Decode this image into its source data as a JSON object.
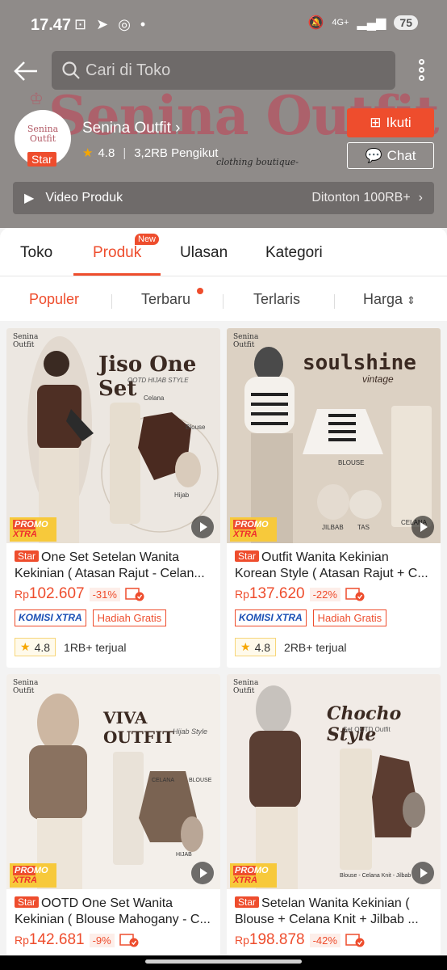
{
  "status": {
    "time": "17.47",
    "network": "4G+",
    "battery": "75"
  },
  "search": {
    "placeholder": "Cari di Toko"
  },
  "banner": {
    "brand": "Senina Outfit",
    "subtitle": "clothing boutique-"
  },
  "shop": {
    "name": "Senina Outfit",
    "logo_text": "Senina Outfit",
    "badge": "Star",
    "rating": "4.8",
    "followers": "3,2RB Pengikut",
    "follow_label": "Ikuti",
    "chat_label": "Chat"
  },
  "video": {
    "label": "Video Produk",
    "views": "Ditonton 100RB+"
  },
  "tabs": [
    {
      "label": "Toko"
    },
    {
      "label": "Produk",
      "badge": "New"
    },
    {
      "label": "Ulasan"
    },
    {
      "label": "Kategori"
    }
  ],
  "sort": [
    "Populer",
    "Terbaru",
    "Terlaris",
    "Harga"
  ],
  "colors": {
    "accent": "#ee4d2d",
    "header_bg": "#8f8b89"
  },
  "products": [
    {
      "badge": "Star",
      "name": "One Set Setelan Wanita Kekinian ( Atasan Rajut - Celan...",
      "price_cur": "Rp",
      "price": "102.607",
      "discount": "-31%",
      "tag1": "KOMISI XTRA",
      "tag2": "Hadiah Gratis",
      "rating": "4.8",
      "sold": "1RB+ terjual",
      "img_title": "Jiso One Set",
      "img_sub": "OOTD HIJAB STYLE",
      "img_brand": "Senina Outfit",
      "img_labels": [
        "Celana",
        "Blouse",
        "Hijab"
      ],
      "promo": "PROMO",
      "promo2": "XTRA"
    },
    {
      "badge": "Star",
      "name": "Outfit Wanita Kekinian Korean Style ( Atasan Rajut + C...",
      "price_cur": "Rp",
      "price": "137.620",
      "discount": "-22%",
      "tag1": "KOMISI XTRA",
      "tag2": "Hadiah Gratis",
      "rating": "4.8",
      "sold": "2RB+ terjual",
      "img_title": "soulshine",
      "img_sub": "vintage",
      "img_brand": "Senina Outfit",
      "img_labels": [
        "BLOUSE",
        "JILBAB",
        "TAS",
        "CELANA"
      ],
      "promo": "PROMO",
      "promo2": "XTRA"
    },
    {
      "badge": "Star",
      "name": "OOTD One Set Wanita Kekinian ( Blouse Mahogany - C...",
      "price_cur": "Rp",
      "price": "142.681",
      "discount": "-9%",
      "img_title": "VIVA OUTFIT",
      "img_sub": "Hijab Style",
      "img_brand": "Senina Outfit",
      "img_labels": [
        "CELANA",
        "BLOUSE",
        "HIJAB"
      ],
      "promo": "PROMO",
      "promo2": "XTRA"
    },
    {
      "badge": "Star",
      "name": "Setelan Wanita Kekinian ( Blouse + Celana Knit + Jilbab ...",
      "price_cur": "Rp",
      "price": "198.878",
      "discount": "-42%",
      "img_title": "Chocho Style",
      "img_sub": "Set OOTD Outfit",
      "img_brand": "Senina Outfit",
      "img_labels": [
        "Blouse - Celana Knit - Jilbab"
      ],
      "promo": "PROMO",
      "promo2": "XTRA"
    }
  ]
}
